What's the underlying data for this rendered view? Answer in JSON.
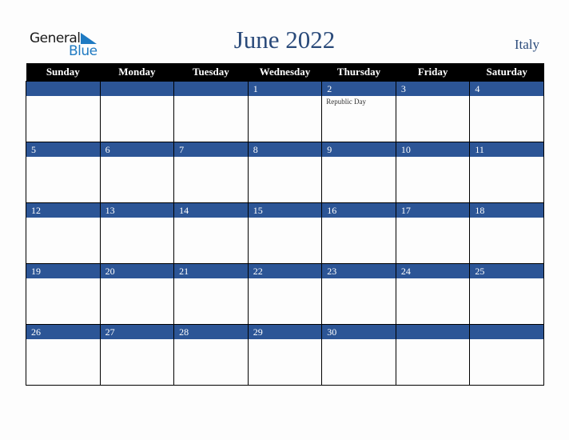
{
  "logo": {
    "line1": "General",
    "line2": "Blue",
    "accent_color": "#1f7ac2"
  },
  "header": {
    "title": "June 2022",
    "country": "Italy"
  },
  "weekdays": [
    "Sunday",
    "Monday",
    "Tuesday",
    "Wednesday",
    "Thursday",
    "Friday",
    "Saturday"
  ],
  "colors": {
    "header_bg": "#000000",
    "day_band": "#2c5596",
    "title_color": "#2a4a7a"
  },
  "weeks": [
    [
      {
        "day": ""
      },
      {
        "day": ""
      },
      {
        "day": ""
      },
      {
        "day": "1"
      },
      {
        "day": "2",
        "holiday": "Republic Day"
      },
      {
        "day": "3"
      },
      {
        "day": "4"
      }
    ],
    [
      {
        "day": "5"
      },
      {
        "day": "6"
      },
      {
        "day": "7"
      },
      {
        "day": "8"
      },
      {
        "day": "9"
      },
      {
        "day": "10"
      },
      {
        "day": "11"
      }
    ],
    [
      {
        "day": "12"
      },
      {
        "day": "13"
      },
      {
        "day": "14"
      },
      {
        "day": "15"
      },
      {
        "day": "16"
      },
      {
        "day": "17"
      },
      {
        "day": "18"
      }
    ],
    [
      {
        "day": "19"
      },
      {
        "day": "20"
      },
      {
        "day": "21"
      },
      {
        "day": "22"
      },
      {
        "day": "23"
      },
      {
        "day": "24"
      },
      {
        "day": "25"
      }
    ],
    [
      {
        "day": "26"
      },
      {
        "day": "27"
      },
      {
        "day": "28"
      },
      {
        "day": "29"
      },
      {
        "day": "30"
      },
      {
        "day": ""
      },
      {
        "day": ""
      }
    ]
  ]
}
